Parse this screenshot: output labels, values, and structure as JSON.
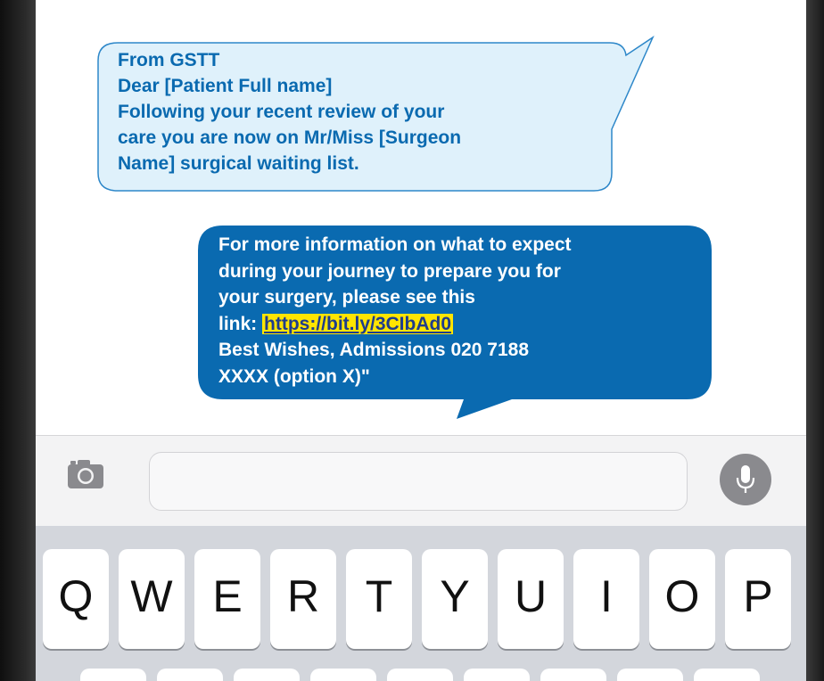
{
  "message_incoming": {
    "lines": [
      "From GSTT",
      "Dear [Patient Full name]",
      "Following your recent review of your",
      "care you are now on Mr/Miss [Surgeon",
      "Name] surgical waiting list."
    ]
  },
  "message_outgoing": {
    "line1": "For more information on what to expect",
    "line2": "during your journey to prepare you for",
    "line3": "your surgery, please see this",
    "link_prefix": "link: ",
    "link_text": "https://bit.ly/3CIbAd0",
    "line5": "Best Wishes, Admissions  020 7188",
    "line6": "XXXX (option X)\""
  },
  "input_bar": {
    "camera_icon": "camera-icon",
    "mic_icon": "microphone-icon",
    "text_value": ""
  },
  "keyboard": {
    "row1": [
      "Q",
      "W",
      "E",
      "R",
      "T",
      "Y",
      "U",
      "I",
      "O",
      "P"
    ]
  },
  "colors": {
    "incoming_bubble": "#dff1fb",
    "incoming_text": "#0a6ab0",
    "outgoing_bubble": "#0a6ab0",
    "link_highlight": "#ffe500"
  }
}
